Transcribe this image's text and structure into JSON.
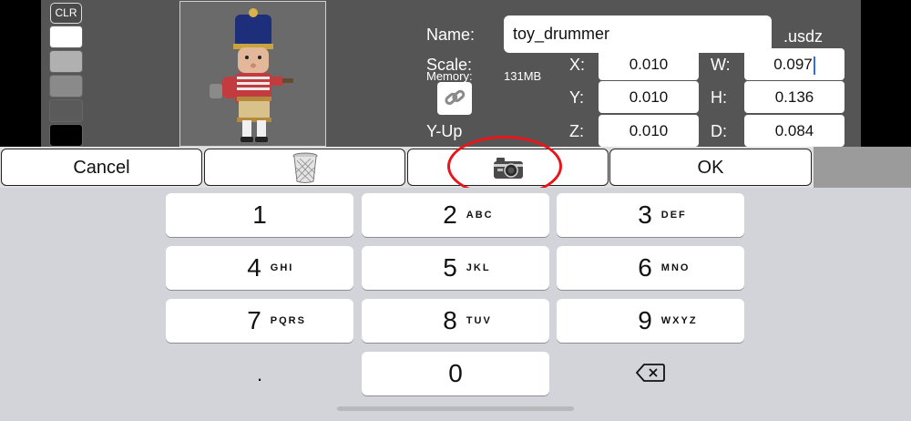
{
  "swatches": {
    "clr_label": "CLR",
    "colors": [
      "#ffffff",
      "#b0b0b0",
      "#8a8a8a",
      "#5a5a5a",
      "#000000"
    ]
  },
  "form": {
    "name_label": "Name:",
    "name_value": "toy_drummer",
    "extension": ".usdz",
    "scale_label": "Scale:",
    "memory_label": "Memory:",
    "memory_value": "131MB",
    "yup_label": "Y-Up",
    "x_label": "X:",
    "x_value": "0.010",
    "y_label": "Y:",
    "y_value": "0.010",
    "z_label": "Z:",
    "z_value": "0.010",
    "w_label": "W:",
    "w_value": "0.097",
    "h_label": "H:",
    "h_value": "0.136",
    "d_label": "D:",
    "d_value": "0.084"
  },
  "actions": {
    "cancel_label": "Cancel",
    "trash_icon": "trash-icon",
    "camera_icon": "camera-icon",
    "ok_label": "OK"
  },
  "keypad": {
    "keys": [
      {
        "digit": "1",
        "letters": ""
      },
      {
        "digit": "2",
        "letters": "ABC"
      },
      {
        "digit": "3",
        "letters": "DEF"
      },
      {
        "digit": "4",
        "letters": "GHI"
      },
      {
        "digit": "5",
        "letters": "JKL"
      },
      {
        "digit": "6",
        "letters": "MNO"
      },
      {
        "digit": "7",
        "letters": "PQRS"
      },
      {
        "digit": "8",
        "letters": "TUV"
      },
      {
        "digit": "9",
        "letters": "WXYZ"
      },
      {
        "digit": "0",
        "letters": ""
      }
    ],
    "decimal": ".",
    "backspace_icon": "backspace-icon"
  }
}
